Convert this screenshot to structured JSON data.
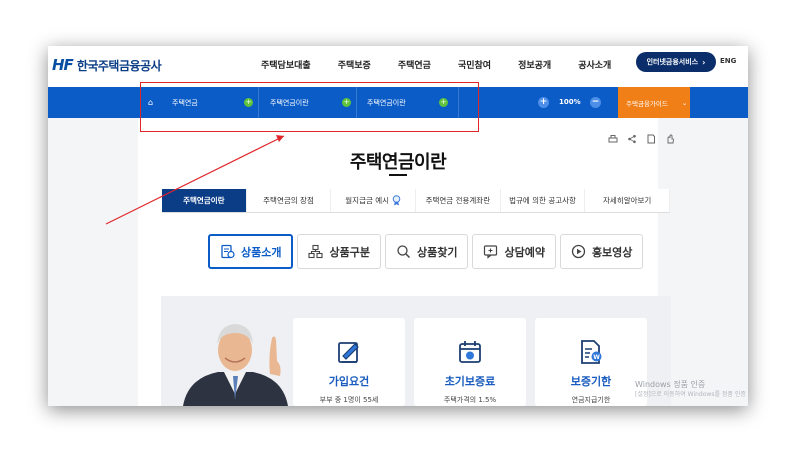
{
  "header": {
    "logo_mark": "HF",
    "logo_text": "한국주택금융공사",
    "nav": [
      "주택담보대출",
      "주택보증",
      "주택연금",
      "국민참여",
      "정보공개",
      "공사소개"
    ],
    "internet_service": "인터넷금융서비스",
    "internet_service_arrow": "›",
    "lang": "ENG"
  },
  "locbar": {
    "home": "⌂",
    "crumbs": [
      "주택연금",
      "주택연금이란",
      "주택연금이란"
    ],
    "dot_symbol": "+",
    "zoom_in": "+",
    "zoom_value": "100%",
    "zoom_out": "−",
    "guide": "주택금융가이드",
    "guide_arrow": "⌄"
  },
  "page": {
    "title": "주택연금이란"
  },
  "tabs": [
    {
      "label": "주택연금이란",
      "active": true
    },
    {
      "label": "주택연금의 장점",
      "active": false
    },
    {
      "label": "월지급금 예시",
      "active": false,
      "icon": "medal-icon"
    },
    {
      "label": "주택연금 전용계좌란",
      "active": false
    },
    {
      "label": "법규에 의한 공고사항",
      "active": false
    },
    {
      "label": "자세히알아보기",
      "active": false
    }
  ],
  "subtabs": [
    {
      "label": "상품소개",
      "active": true,
      "icon": "document-badge-icon"
    },
    {
      "label": "상품구분",
      "active": false,
      "icon": "hierarchy-icon"
    },
    {
      "label": "상품찾기",
      "active": false,
      "icon": "magnifier-icon"
    },
    {
      "label": "상담예약",
      "active": false,
      "icon": "consult-icon"
    },
    {
      "label": "홍보영상",
      "active": false,
      "icon": "play-icon"
    }
  ],
  "cards": [
    {
      "title": "가입요건",
      "desc": "부부 중 1명이 55세",
      "icon": "pen-document-icon"
    },
    {
      "title": "초기보증료",
      "desc": "주택가격의 1.5%",
      "icon": "calendar-coin-icon"
    },
    {
      "title": "보증기한",
      "desc": "연금지급기한",
      "icon": "won-document-icon"
    }
  ],
  "watermark": {
    "line1": "Windows 정품 인증",
    "line2": "[설정]으로 이동하여 Windows를 정품 인증"
  },
  "colors": {
    "brand_blue": "#0b5cc7",
    "navy": "#0b3d87",
    "orange": "#f07f18",
    "green_dot": "#5fc33b",
    "annotation_red": "#e0262b"
  }
}
